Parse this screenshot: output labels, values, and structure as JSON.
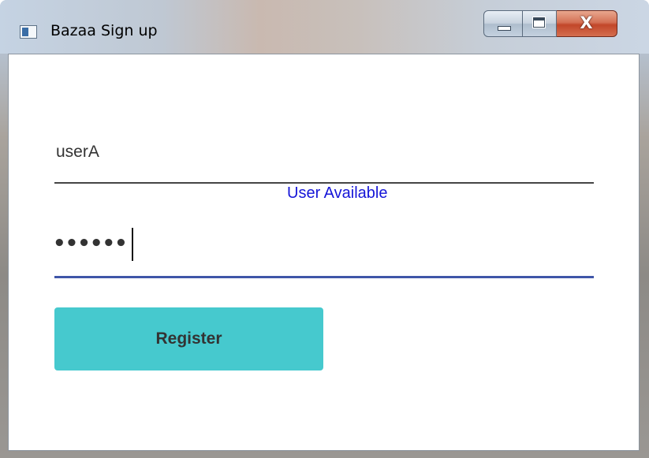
{
  "window": {
    "title": "Bazaa Sign up",
    "controls": {
      "minimize": "minimize",
      "maximize": "maximize",
      "close_label": "X"
    }
  },
  "form": {
    "username_value": "userA",
    "availability_message": "User Available",
    "password_masked": "••••••",
    "register_label": "Register"
  },
  "icons": {
    "app": "app-window-icon",
    "minimize": "minimize-icon",
    "maximize": "maximize-icon",
    "close": "close-icon"
  },
  "colors": {
    "availability_text": "#1515d8",
    "password_underline_focused": "#3f56a8",
    "username_underline": "#454545",
    "register_button": "#46c9ce",
    "close_button": "#c2472a"
  }
}
